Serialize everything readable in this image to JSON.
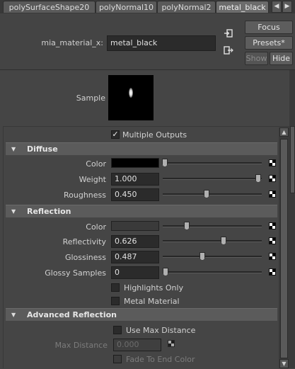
{
  "tabs": [
    {
      "label": "polySurfaceShape20",
      "active": false
    },
    {
      "label": "polyNormal10",
      "active": false
    },
    {
      "label": "polyNormal2",
      "active": false
    },
    {
      "label": "metal_black",
      "active": true
    }
  ],
  "tab_nav": {
    "left": "◀",
    "right": "▶"
  },
  "header": {
    "node_type_label": "mia_material_x:",
    "node_name": "metal_black",
    "focus_label": "Focus",
    "presets_label": "Presets*",
    "show_label": "Show",
    "hide_label": "Hide"
  },
  "sample": {
    "label": "Sample"
  },
  "multiple_outputs": {
    "label": "Multiple Outputs",
    "checked": true
  },
  "sections": {
    "diffuse": "Diffuse",
    "reflection": "Reflection",
    "advanced_reflection": "Advanced Reflection"
  },
  "diffuse": {
    "color": {
      "label": "Color",
      "swatch": "#000000",
      "slider": 0.0
    },
    "weight": {
      "label": "Weight",
      "value": "1.000",
      "slider": 1.0
    },
    "roughness": {
      "label": "Roughness",
      "value": "0.450",
      "slider": 0.45
    }
  },
  "reflection": {
    "color": {
      "label": "Color",
      "swatch": "#3a3a3a",
      "slider": 0.23
    },
    "reflectivity": {
      "label": "Reflectivity",
      "value": "0.626",
      "slider": 0.626
    },
    "glossiness": {
      "label": "Glossiness",
      "value": "0.487",
      "slider": 0.39
    },
    "glossy_samples": {
      "label": "Glossy Samples",
      "value": "0",
      "slider": 0.0
    },
    "highlights_only": {
      "label": "Highlights Only",
      "checked": false
    },
    "metal_material": {
      "label": "Metal Material",
      "checked": false
    }
  },
  "advanced": {
    "use_max_distance": {
      "label": "Use Max Distance",
      "checked": false
    },
    "max_distance": {
      "label": "Max Distance",
      "value": "0.000"
    },
    "fade_to_end_color": {
      "label": "Fade To End Color",
      "checked": false
    }
  },
  "icons": {
    "collapse": "▼",
    "checkmark": "✓"
  }
}
